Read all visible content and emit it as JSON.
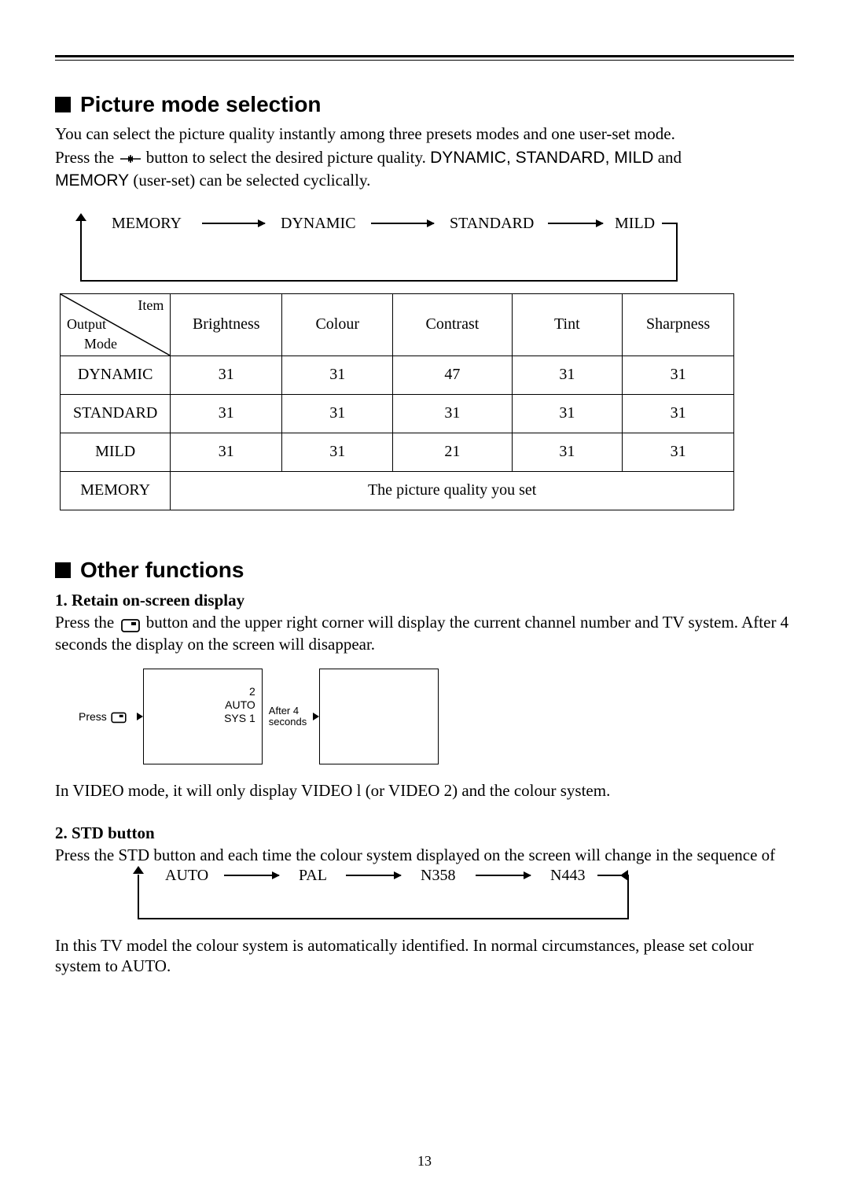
{
  "page_number": "13",
  "section1": {
    "title": "Picture mode selection",
    "para1_a": "You can select the picture quality instantly among three presets modes and one user-set mode.",
    "para2_a": "Press the",
    "para2_b": "button to select the desired picture quality.",
    "para2_modes": "DYNAMIC, STANDARD, MILD",
    "para2_and": " and ",
    "para2_memory": "MEMORY",
    "para2_c": " (user-set) can be selected cyclically."
  },
  "cycle1": {
    "items": [
      "MEMORY",
      "DYNAMIC",
      "STANDARD",
      "MILD"
    ]
  },
  "table": {
    "corner_top": "Item",
    "corner_left": "Output",
    "corner_bottom": "Mode",
    "headers": [
      "Brightness",
      "Colour",
      "Contrast",
      "Tint",
      "Sharpness"
    ],
    "rows": [
      {
        "mode": "DYNAMIC",
        "vals": [
          "31",
          "31",
          "47",
          "31",
          "31"
        ]
      },
      {
        "mode": "STANDARD",
        "vals": [
          "31",
          "31",
          "31",
          "31",
          "31"
        ]
      },
      {
        "mode": "MILD",
        "vals": [
          "31",
          "31",
          "21",
          "31",
          "31"
        ]
      }
    ],
    "memory_row_label": "MEMORY",
    "memory_row_text": "The picture quality you set"
  },
  "section2": {
    "title": "Other functions",
    "sub1_title": "1. Retain on-screen display",
    "sub1_a": "Press the",
    "sub1_b": "button and the upper right corner will display the current channel number and TV system. After 4 seconds the display on the screen will disappear.",
    "osd": {
      "press_label": "Press",
      "line1": "2",
      "line2": "AUTO",
      "line3": "SYS 1",
      "after_label_1": "After 4",
      "after_label_2": "seconds"
    },
    "sub1_note": "In VIDEO mode, it will only display VIDEO l (or VIDEO 2) and the colour system.",
    "sub2_title": "2. STD button",
    "sub2_text": "Press the STD button and each time the colour system displayed on the screen will change in the sequence of",
    "cycle2": {
      "items": [
        "AUTO",
        "PAL",
        "N358",
        "N443"
      ]
    },
    "sub2_note": "In this TV model the colour system is automatically identified. In normal circumstances, please set colour system to AUTO."
  }
}
